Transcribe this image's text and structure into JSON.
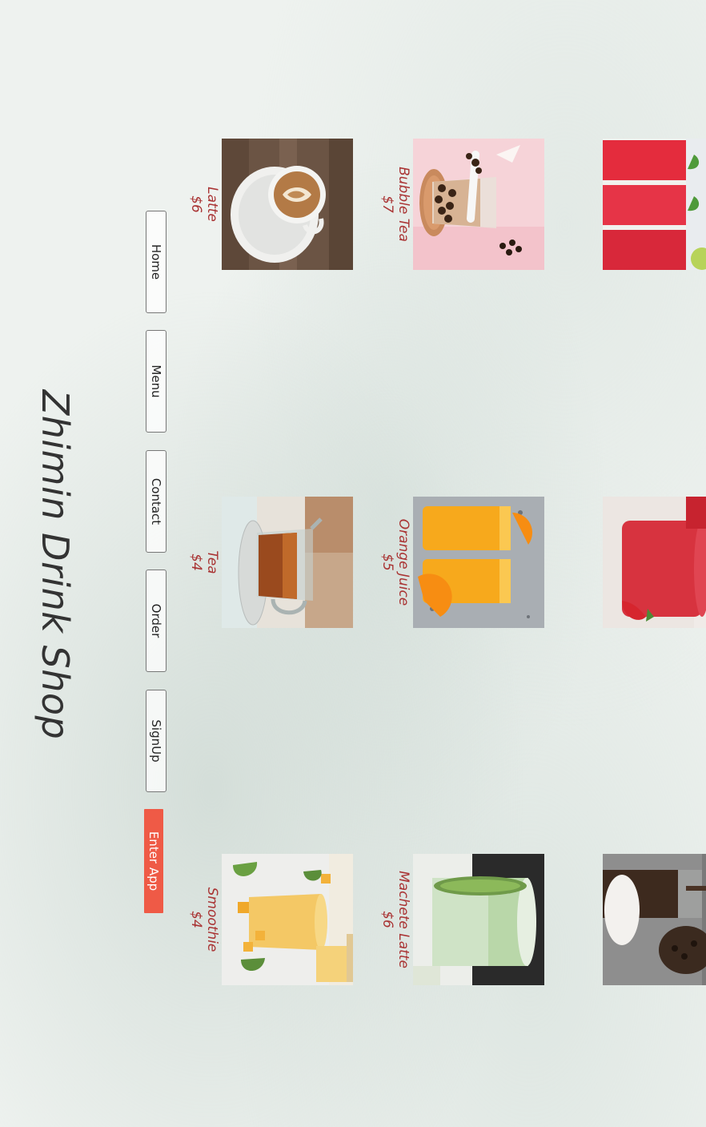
{
  "shop": {
    "title": "Zhimin Drink Shop"
  },
  "nav": {
    "home": "Home",
    "menu": "Menu",
    "contact": "Contact",
    "order": "Order",
    "signup": "SignUp",
    "enter_app": "Enter App"
  },
  "colors": {
    "accent": "#ef5a46",
    "price_text": "#a93333",
    "background": "#eef2ef"
  },
  "drinks": [
    {
      "name": "Latte",
      "price": "$6",
      "icon": "latte-image"
    },
    {
      "name": "Tea",
      "price": "$4",
      "icon": "tea-image"
    },
    {
      "name": "Smoothie",
      "price": "$4",
      "icon": "smoothie-image"
    },
    {
      "name": "Bubble Tea",
      "price": "$7",
      "icon": "bubble-tea-image"
    },
    {
      "name": "Orange Juice",
      "price": "$5",
      "icon": "orange-juice-image"
    },
    {
      "name": "Machete Latte",
      "price": "$6",
      "icon": "matcha-latte-image"
    },
    {
      "icon": "watermelon-juice-image"
    },
    {
      "icon": "strawberry-juice-image"
    },
    {
      "icon": "iced-coffee-image"
    }
  ]
}
